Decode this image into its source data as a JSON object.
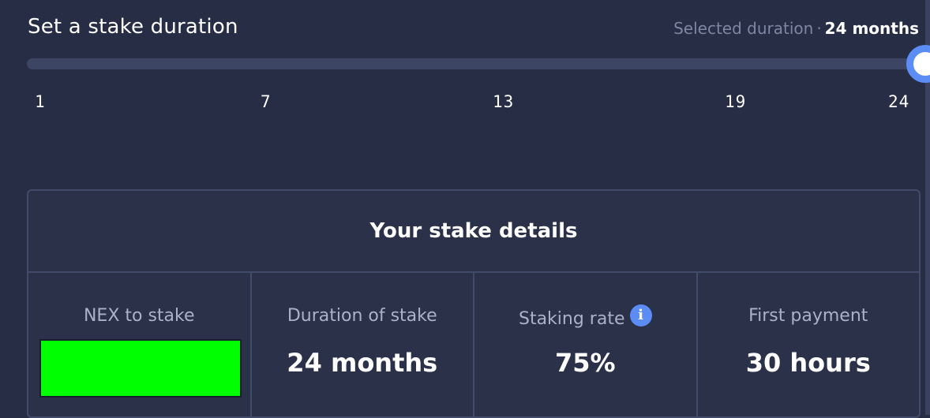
{
  "duration": {
    "title": "Set a stake duration",
    "selected_label": "Selected duration",
    "separator": "·",
    "selected_value": "24 months",
    "slider": {
      "min": 1,
      "max": 24,
      "value": 24,
      "ticks": [
        "1",
        "7",
        "13",
        "19",
        "24"
      ]
    }
  },
  "details": {
    "title": "Your stake details",
    "nex_to_stake": {
      "label": "NEX to stake",
      "value": ""
    },
    "duration_of_stake": {
      "label": "Duration of stake",
      "value": "24 months"
    },
    "staking_rate": {
      "label": "Staking rate",
      "info_icon": "info-icon",
      "info_glyph": "i",
      "value": "75%"
    },
    "first_payment": {
      "label": "First payment",
      "value": "30 hours"
    }
  },
  "colors": {
    "background": "#272d44",
    "accent": "#5b8df5",
    "input_fill": "#00ff00",
    "muted_text": "#7d86a3"
  }
}
